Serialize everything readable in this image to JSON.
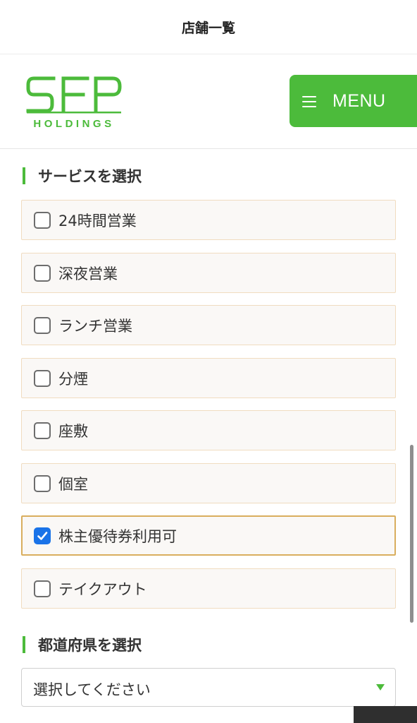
{
  "page": {
    "title": "店舗一覧"
  },
  "header": {
    "logo_main": "SFP",
    "logo_sub": "HOLDINGS",
    "menu_label": "MENU"
  },
  "services": {
    "heading": "サービスを選択",
    "items": [
      {
        "label": "24時間営業",
        "checked": false
      },
      {
        "label": "深夜営業",
        "checked": false
      },
      {
        "label": "ランチ営業",
        "checked": false
      },
      {
        "label": "分煙",
        "checked": false
      },
      {
        "label": "座敷",
        "checked": false
      },
      {
        "label": "個室",
        "checked": false
      },
      {
        "label": "株主優待券利用可",
        "checked": true
      },
      {
        "label": "テイクアウト",
        "checked": false
      }
    ]
  },
  "prefecture": {
    "heading": "都道府県を選択",
    "selected": "選択してください"
  },
  "colors": {
    "accent": "#4cbb3b",
    "check": "#1a73e8",
    "option_border": "#f0dcc0",
    "checked_border": "#d9ae5e"
  },
  "icons": {
    "menu": "hamburger-icon",
    "select": "triangle-down-icon",
    "check": "checkmark-icon"
  }
}
